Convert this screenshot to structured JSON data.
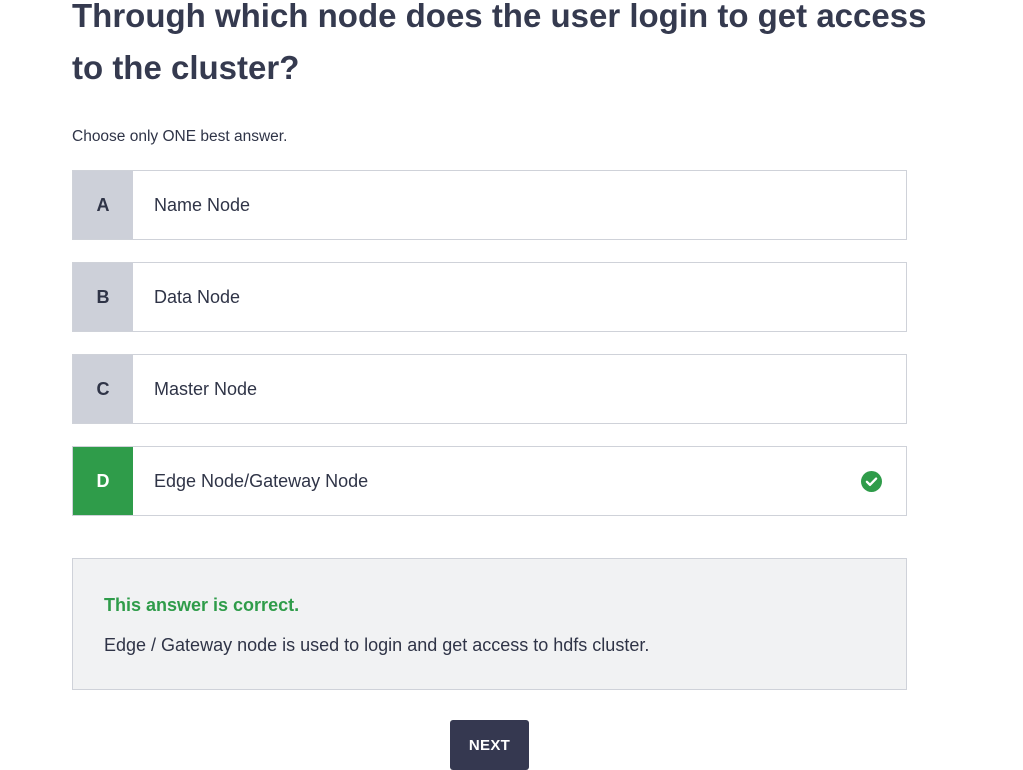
{
  "question": {
    "title": "Through which node does the user login to get access to the cluster?",
    "instruction": "Choose only ONE best answer."
  },
  "options": [
    {
      "letter": "A",
      "label": "Name Node",
      "state": "default"
    },
    {
      "letter": "B",
      "label": "Data Node",
      "state": "default"
    },
    {
      "letter": "C",
      "label": "Master Node",
      "state": "default"
    },
    {
      "letter": "D",
      "label": "Edge Node/Gateway Node",
      "state": "correct",
      "icon": "check-circle-icon"
    }
  ],
  "feedback": {
    "status": "This answer is correct.",
    "explanation": "Edge / Gateway node is used to login and get access to hdfs cluster."
  },
  "actions": {
    "next_label": "NEXT"
  },
  "colors": {
    "correct": "#2f9c4a",
    "letter_bg": "#cdd0d9",
    "button_bg": "#353850",
    "feedback_bg": "#f1f2f3"
  }
}
